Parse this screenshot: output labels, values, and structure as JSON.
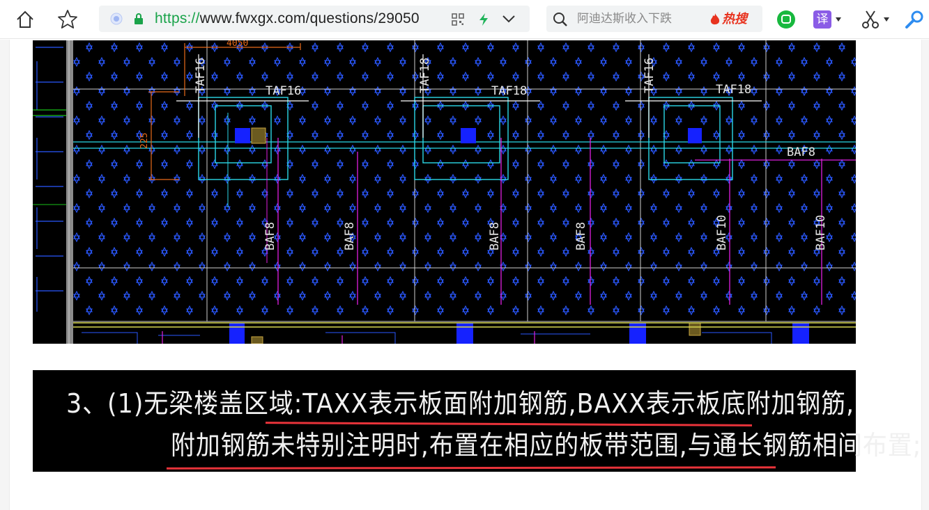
{
  "browser": {
    "url_scheme": "https://",
    "url_rest": "www.fwxgx.com/questions/29050",
    "search_placeholder": "阿迪达斯收入下跌",
    "hot_label": "热搜",
    "translate_label": "译",
    "icons": [
      "home-icon",
      "star-icon",
      "secure-lock-icon",
      "qr-code-icon",
      "lightning-icon",
      "chevron-down-icon",
      "search-icon",
      "fire-icon",
      "chat-icon",
      "translate-icon",
      "scissors-icon",
      "magnifier-icon"
    ]
  },
  "cad": {
    "top_labels": [
      "TAF16",
      "TAF16",
      "TAF18",
      "TAF18",
      "TAF16",
      "TAF18"
    ],
    "bottom_labels": [
      "BAF8",
      "BAF8",
      "BAF8",
      "BAF8",
      "BAF10",
      "BAF10"
    ],
    "right_label": "BAF8",
    "dim_top": "4050",
    "dim_left": "225"
  },
  "note": {
    "line1": "3、(1)无梁楼盖区域:TAXX表示板面附加钢筋,BAXX表示板底附加钢筋,",
    "line2": "附加钢筋未特别注明时,布置在相应的板带范围,与通长钢筋相间布置;"
  },
  "colors": {
    "cad_background": "#000000",
    "grid_blue": "#2a58ff",
    "rebar_magenta": "#e020e0",
    "underline_red": "#e8333a",
    "url_green": "#1aa34a",
    "hot_red": "#e8331f"
  }
}
